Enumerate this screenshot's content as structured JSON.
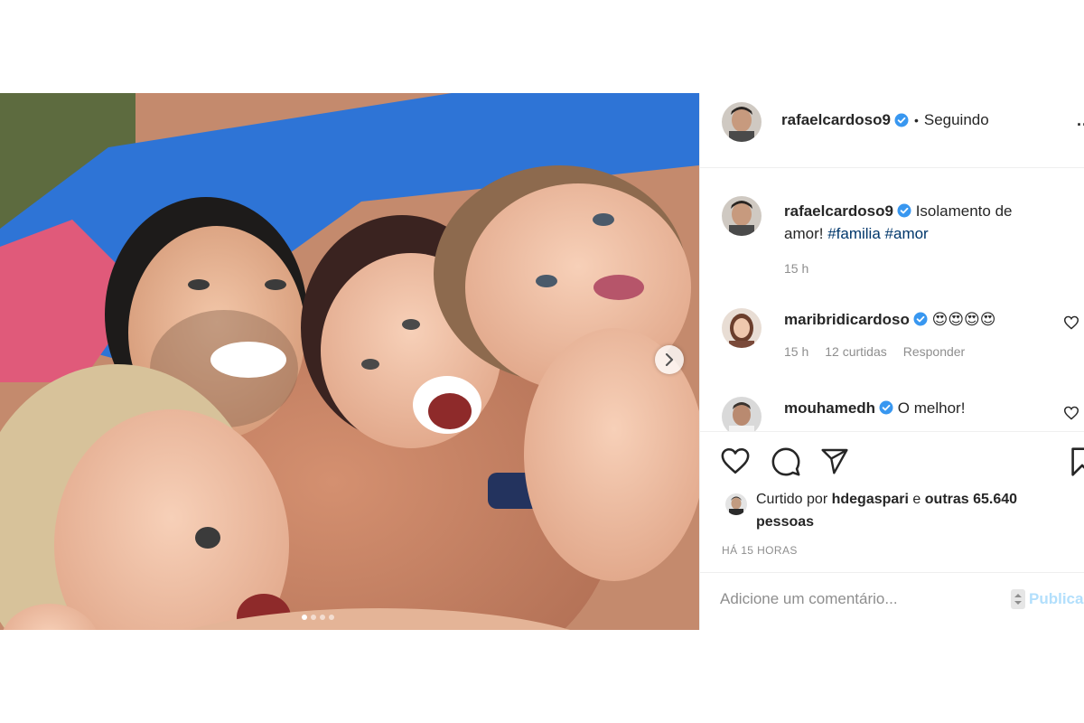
{
  "post": {
    "author": {
      "username": "rafaelcardoso9",
      "verified": true,
      "follow_status": "Seguindo"
    },
    "header": {
      "separator": "•",
      "more_label": ".."
    },
    "caption": {
      "username": "rafaelcardoso9",
      "text": "Isolamento de amor!",
      "hashtags": [
        "#familia",
        "#amor"
      ],
      "time": "15 h"
    },
    "comments": [
      {
        "username": "maribridicardoso",
        "verified": true,
        "text": "😍😍😍😍",
        "time": "15 h",
        "likes": "12 curtidas",
        "reply_label": "Responder"
      },
      {
        "username": "mouhamedh",
        "verified": true,
        "text": "O melhor!"
      }
    ],
    "liked_by": {
      "prefix": "Curtido por",
      "user": "hdegaspari",
      "conjunction": "e",
      "others": "outras 65.640 pessoas"
    },
    "timestamp": "HÁ 15 HORAS",
    "comment_input": {
      "placeholder": "Adicione um comentário...",
      "post_label": "Publicar"
    },
    "carousel": {
      "total": 4,
      "current": 1
    }
  },
  "icons": {
    "verified": "verified-badge-icon",
    "like": "heart-icon",
    "comment": "comment-icon",
    "share": "send-icon",
    "save": "bookmark-icon",
    "next": "chevron-right-icon"
  },
  "colors": {
    "verified": "#3897f0",
    "hashtag": "#00376b",
    "muted": "#8e8e8e",
    "border": "#efefef",
    "post_button": "#b2dffc"
  }
}
